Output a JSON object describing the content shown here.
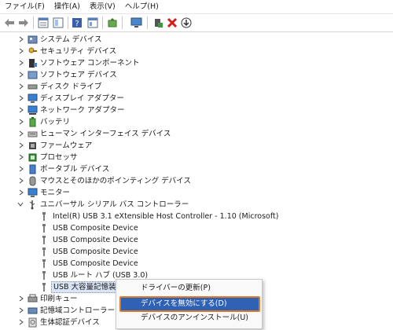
{
  "menu": {
    "items": [
      "ファイル(F)",
      "操作(A)",
      "表示(V)",
      "ヘルプ(H)"
    ]
  },
  "toolbar": {
    "buttons": [
      "back-icon",
      "forward-icon",
      "properties-grid-icon",
      "console-tree-icon",
      "help-icon",
      "details-view-icon",
      "update-driver-icon",
      "monitor-scan-icon",
      "add-driver-icon",
      "uninstall-icon",
      "download-icon"
    ]
  },
  "tree": {
    "categories_top": [
      {
        "label": "システム デバイス",
        "icon": "system-device-icon"
      },
      {
        "label": "セキュリティ デバイス",
        "icon": "security-key-icon"
      },
      {
        "label": "ソフトウェア コンポーネント",
        "icon": "software-component-icon"
      },
      {
        "label": "ソフトウェア デバイス",
        "icon": "software-device-icon"
      },
      {
        "label": "ディスク ドライブ",
        "icon": "disk-drive-icon"
      },
      {
        "label": "ディスプレイ アダプター",
        "icon": "display-adapter-icon"
      },
      {
        "label": "ネットワーク アダプター",
        "icon": "network-adapter-icon"
      },
      {
        "label": "バッテリ",
        "icon": "battery-icon"
      },
      {
        "label": "ヒューマン インターフェイス デバイス",
        "icon": "hid-icon"
      },
      {
        "label": "ファームウェア",
        "icon": "firmware-icon"
      },
      {
        "label": "プロセッサ",
        "icon": "processor-icon"
      },
      {
        "label": "ポータブル デバイス",
        "icon": "portable-device-icon"
      },
      {
        "label": "マウスとそのほかのポインティング デバイス",
        "icon": "mouse-icon"
      },
      {
        "label": "モニター",
        "icon": "monitor-icon"
      }
    ],
    "usb_category": "ユニバーサル シリアル バス コントローラー",
    "usb_children": [
      "Intel(R) USB 3.1 eXtensible Host Controller - 1.10 (Microsoft)",
      "USB Composite Device",
      "USB Composite Device",
      "USB Composite Device",
      "USB Composite Device",
      "USB ルート ハブ (USB 3.0)",
      "USB 大容量記憶装置"
    ],
    "categories_bottom": [
      {
        "label": "印刷キュー",
        "icon": "print-queue-icon"
      },
      {
        "label": "記憶域コントローラー",
        "icon": "storage-controller-icon"
      },
      {
        "label": "生体認証デバイス",
        "icon": "biometric-icon"
      }
    ]
  },
  "context_menu": {
    "update": "ドライバーの更新(P)",
    "disable": "デバイスを無効にする(D)",
    "uninstall": "デバイスのアンインストール(U)"
  },
  "colors": {
    "highlight": "#2f62b5",
    "callout_border": "#e0782a",
    "selection": "#d9e4f5"
  }
}
